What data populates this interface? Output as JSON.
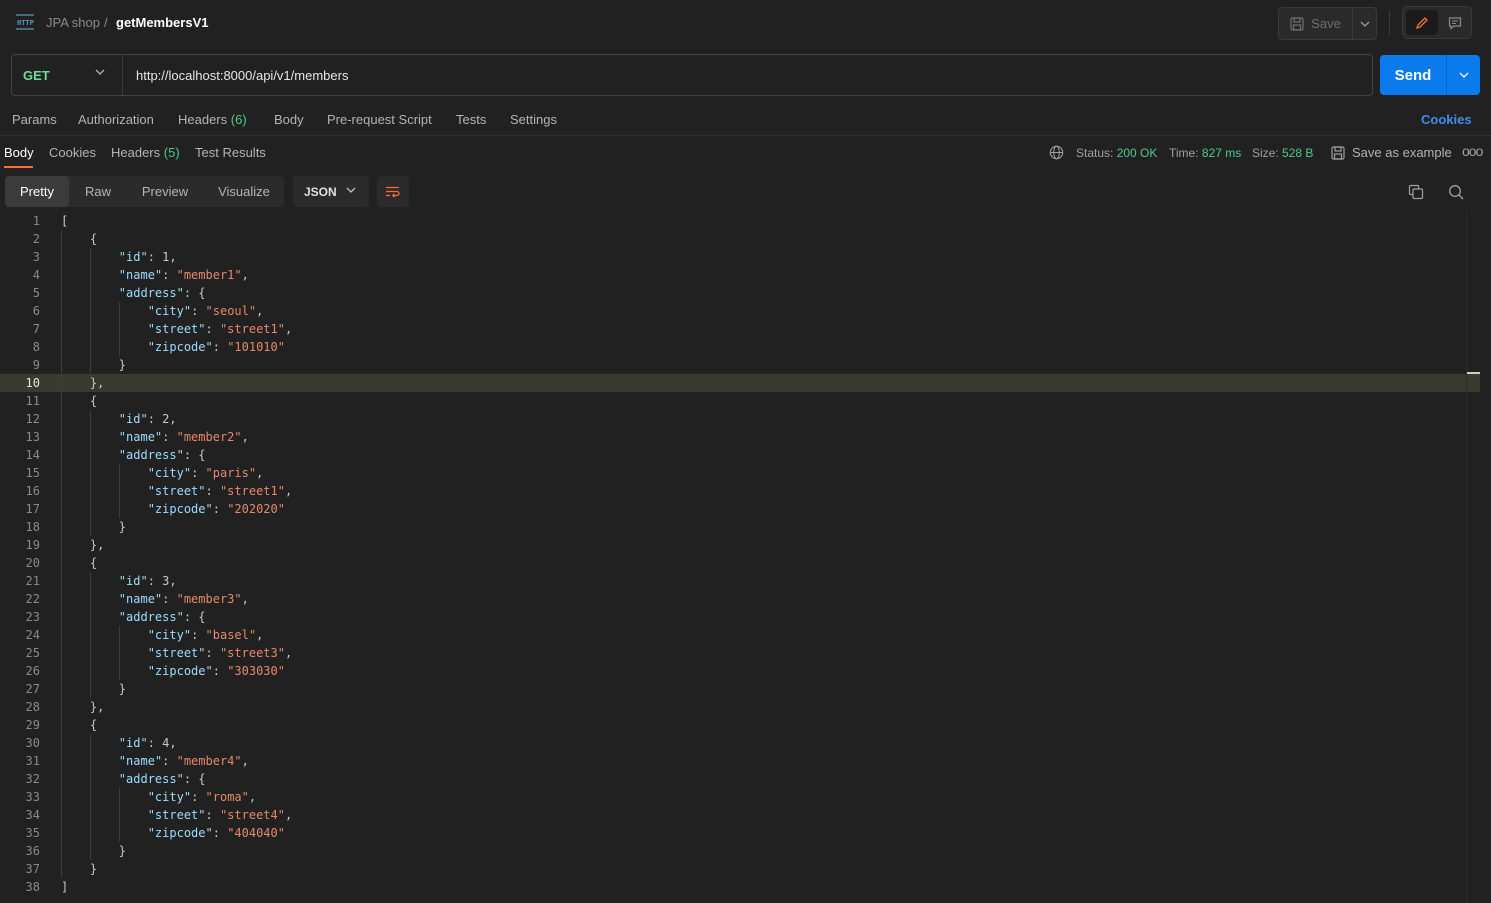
{
  "header": {
    "collection": "JPA shop",
    "separator": "/",
    "request_name": "getMembersV1",
    "save_label": "Save"
  },
  "request": {
    "method": "GET",
    "url": "http://localhost:8000/api/v1/members",
    "send_label": "Send"
  },
  "request_tabs": {
    "params": "Params",
    "authorization": "Authorization",
    "headers": "Headers",
    "headers_count": "(6)",
    "body": "Body",
    "prerequest": "Pre-request Script",
    "tests": "Tests",
    "settings": "Settings",
    "cookies": "Cookies"
  },
  "response_tabs": {
    "body": "Body",
    "cookies": "Cookies",
    "headers": "Headers",
    "headers_count": "(5)",
    "test_results": "Test Results"
  },
  "response_meta": {
    "status_label": "Status:",
    "status_value": "200 OK",
    "time_label": "Time:",
    "time_value": "827 ms",
    "size_label": "Size:",
    "size_value": "528 B",
    "save_example": "Save as example",
    "more": "ooo"
  },
  "view_modes": {
    "pretty": "Pretty",
    "raw": "Raw",
    "preview": "Preview",
    "visualize": "Visualize",
    "format": "JSON"
  },
  "editor": {
    "current_line": 10,
    "members": [
      {
        "id": "1",
        "name": "member1",
        "city": "seoul",
        "street": "street1",
        "zipcode": "101010"
      },
      {
        "id": "2",
        "name": "member2",
        "city": "paris",
        "street": "street1",
        "zipcode": "202020"
      },
      {
        "id": "3",
        "name": "member3",
        "city": "basel",
        "street": "street3",
        "zipcode": "303030"
      },
      {
        "id": "4",
        "name": "member4",
        "city": "roma",
        "street": "street4",
        "zipcode": "404040"
      }
    ]
  },
  "colors": {
    "accent": "#ff6c37",
    "send": "#097bed",
    "status_ok": "#4ec98a",
    "json_key": "#9cdcfe",
    "json_string": "#e6896a"
  }
}
